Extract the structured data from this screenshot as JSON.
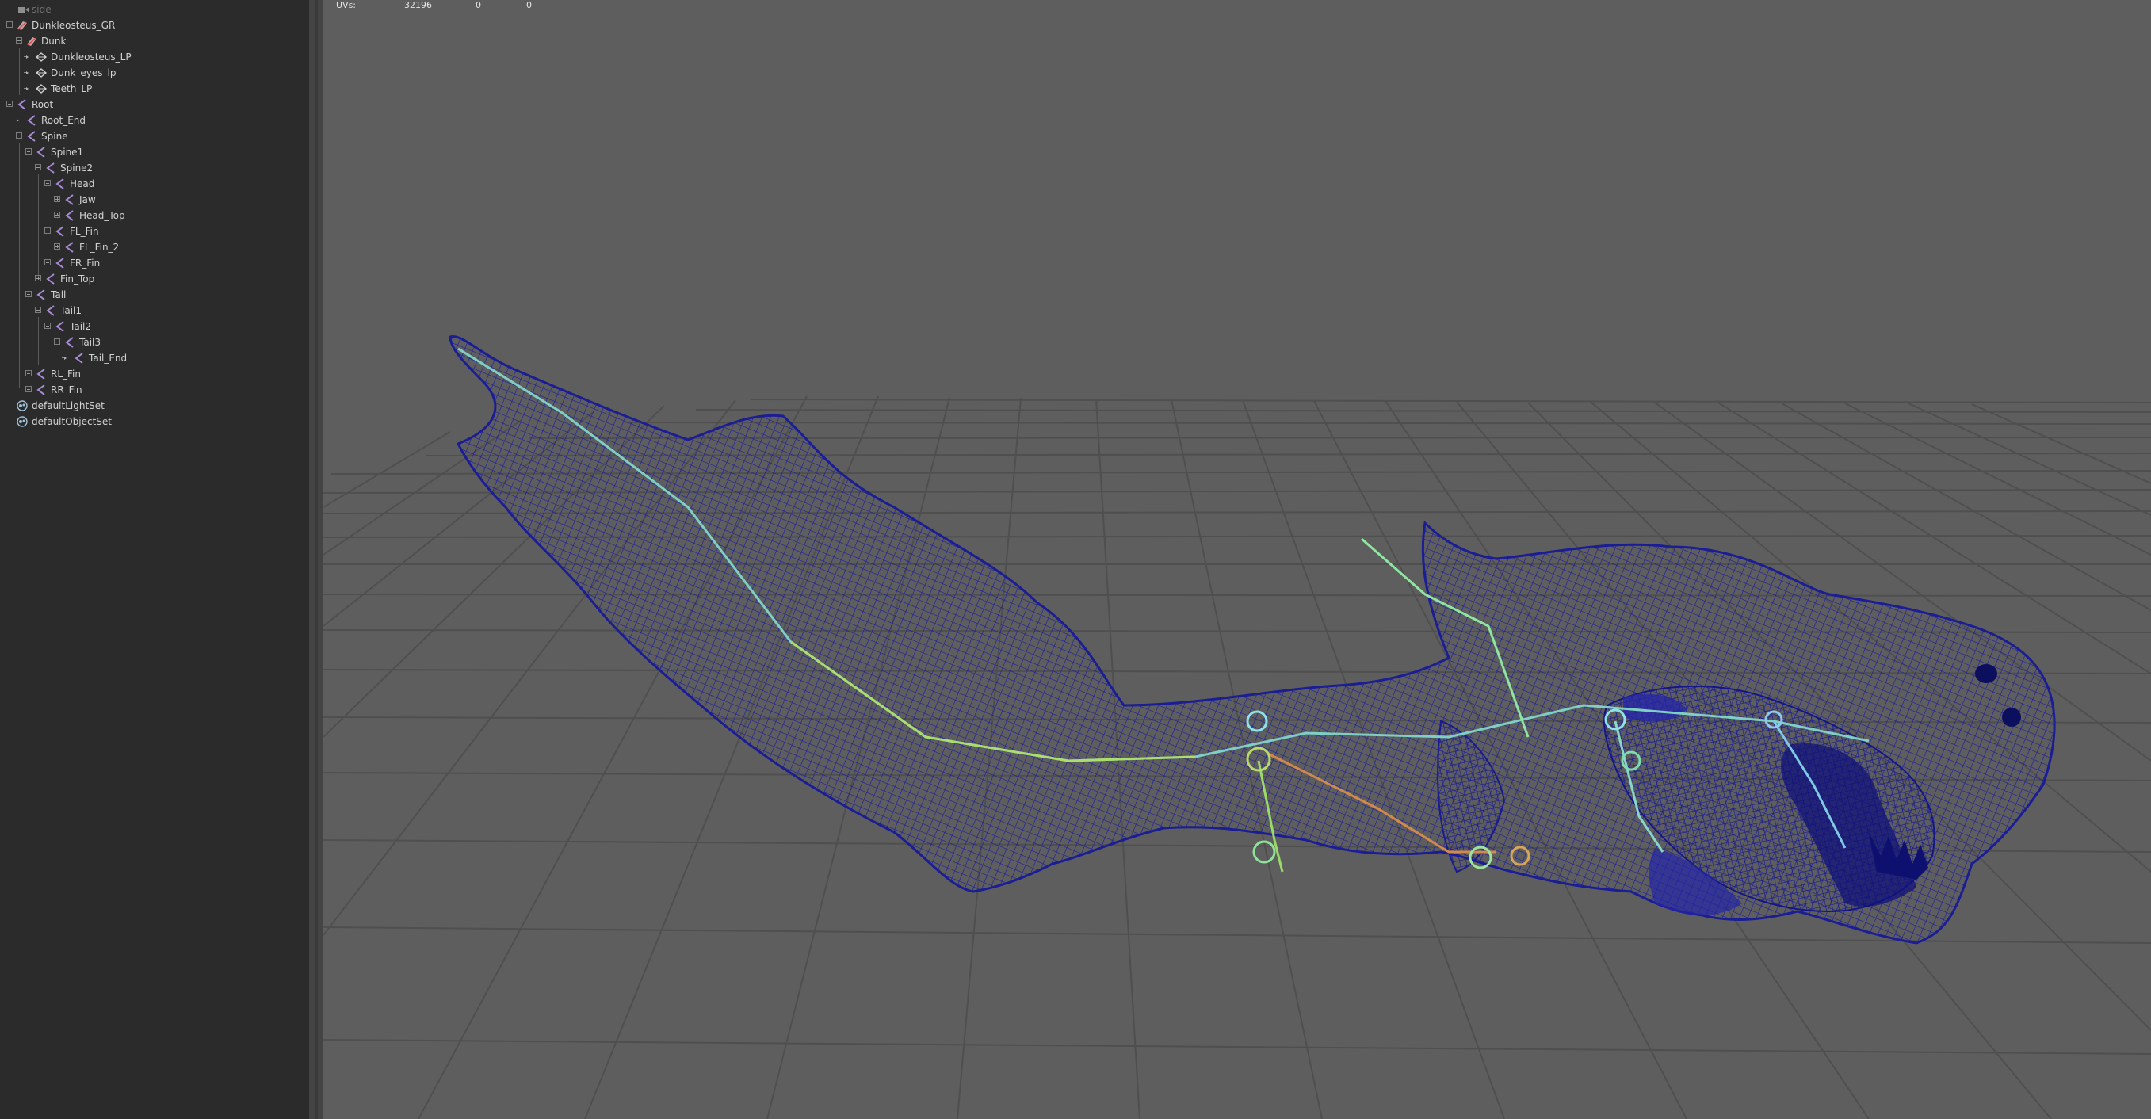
{
  "outliner": {
    "items": [
      {
        "label": "side",
        "type": "camera"
      },
      {
        "label": "Dunkleosteus_GR",
        "type": "group"
      },
      {
        "label": "Dunk",
        "type": "group"
      },
      {
        "label": "Dunkleosteus_LP",
        "type": "mesh"
      },
      {
        "label": "Dunk_eyes_lp",
        "type": "mesh"
      },
      {
        "label": "Teeth_LP",
        "type": "mesh"
      },
      {
        "label": "Root",
        "type": "joint"
      },
      {
        "label": "Root_End",
        "type": "joint"
      },
      {
        "label": "Spine",
        "type": "joint"
      },
      {
        "label": "Spine1",
        "type": "joint"
      },
      {
        "label": "Spine2",
        "type": "joint"
      },
      {
        "label": "Head",
        "type": "joint"
      },
      {
        "label": "Jaw",
        "type": "joint"
      },
      {
        "label": "Head_Top",
        "type": "joint"
      },
      {
        "label": "FL_Fin",
        "type": "joint"
      },
      {
        "label": "FL_Fin_2",
        "type": "joint"
      },
      {
        "label": "FR_Fin",
        "type": "joint"
      },
      {
        "label": "Fin_Top",
        "type": "joint"
      },
      {
        "label": "Tail",
        "type": "joint"
      },
      {
        "label": "Tail1",
        "type": "joint"
      },
      {
        "label": "Tail2",
        "type": "joint"
      },
      {
        "label": "Tail3",
        "type": "joint"
      },
      {
        "label": "Tail_End",
        "type": "joint"
      },
      {
        "label": "RL_Fin",
        "type": "joint"
      },
      {
        "label": "RR_Fin",
        "type": "joint"
      },
      {
        "label": "defaultLightSet",
        "type": "set"
      },
      {
        "label": "defaultObjectSet",
        "type": "set"
      }
    ]
  },
  "hud": {
    "uvs_label": "UVs:",
    "uvs_count": "32196",
    "uvs_selected": "0",
    "uvs_extra": "0"
  },
  "colors": {
    "viewport_bg": "#5e5e5e",
    "outliner_bg": "#2b2b2b",
    "wireframe": "#1d1f9c",
    "grid": "#4e4e4e",
    "joint": "#8fd3e8"
  }
}
